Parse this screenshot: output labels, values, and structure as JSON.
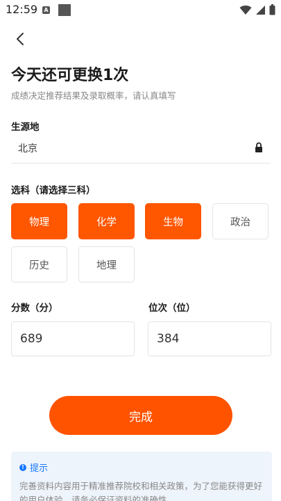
{
  "status": {
    "time": "12:59",
    "notif_letter": "A"
  },
  "icons": {
    "back": "chevron-left-icon",
    "lock": "lock-icon",
    "wifi": "wifi-icon",
    "signal": "signal-icon",
    "battery": "battery-icon",
    "info": "info-icon"
  },
  "header": {
    "title": "今天还可更换1次",
    "subtitle": "成绩决定推荐结果及录取概率，请认真填写"
  },
  "source": {
    "label": "生源地",
    "value": "北京"
  },
  "subjects": {
    "label": "选科（请选择三科）",
    "items": [
      {
        "name": "物理",
        "selected": true
      },
      {
        "name": "化学",
        "selected": true
      },
      {
        "name": "生物",
        "selected": true
      },
      {
        "name": "政治",
        "selected": false
      },
      {
        "name": "历史",
        "selected": false
      },
      {
        "name": "地理",
        "selected": false
      }
    ]
  },
  "score": {
    "label": "分数（分）",
    "value": "689"
  },
  "rank": {
    "label": "位次（位）",
    "value": "384"
  },
  "done_button": "完成",
  "tip": {
    "title": "提示",
    "text": "完善资料内容用于精准推荐院校和相关政策，为了您能获得更好的用户体验，请务必保证资料的准确性"
  },
  "colors": {
    "accent": "#ff5600",
    "tip_blue": "#1677ff",
    "tip_bg": "#eef4fb"
  }
}
